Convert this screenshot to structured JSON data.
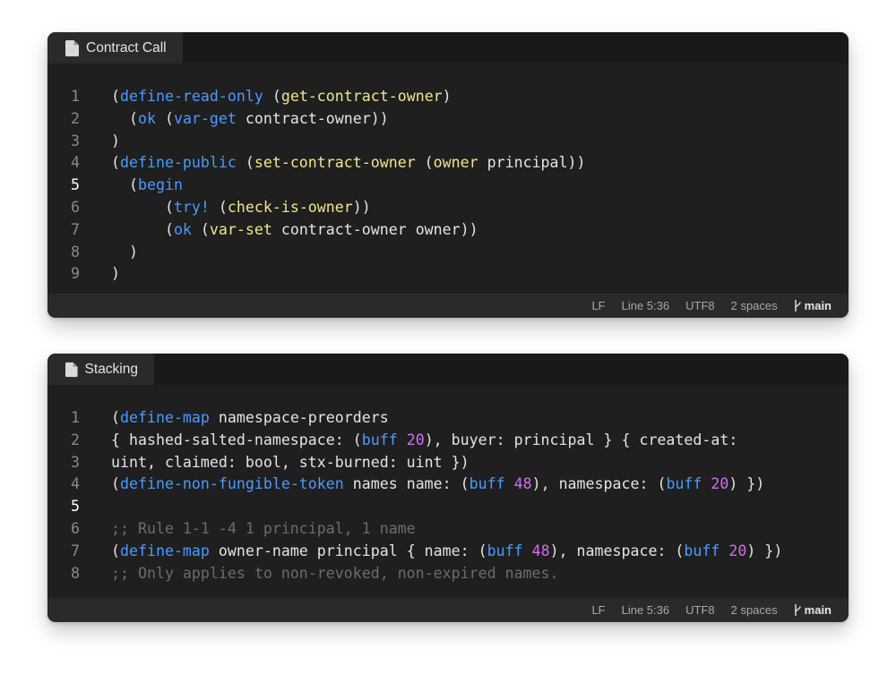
{
  "editors": [
    {
      "tab_icon": "file-icon",
      "tab_label": "Contract Call",
      "active_line": 5,
      "lines": [
        {
          "n": "1",
          "tokens": [
            {
              "t": "(",
              "c": "tx"
            },
            {
              "t": "define-read-only",
              "c": "kw"
            },
            {
              "t": " (",
              "c": "tx"
            },
            {
              "t": "get-contract-owner",
              "c": "fn"
            },
            {
              "t": ")",
              "c": "tx"
            }
          ]
        },
        {
          "n": "2",
          "tokens": [
            {
              "t": "  (",
              "c": "tx"
            },
            {
              "t": "ok",
              "c": "kw"
            },
            {
              "t": " (",
              "c": "tx"
            },
            {
              "t": "var-get",
              "c": "kw"
            },
            {
              "t": " contract-owner))",
              "c": "tx"
            }
          ]
        },
        {
          "n": "3",
          "tokens": [
            {
              "t": ")",
              "c": "tx"
            }
          ]
        },
        {
          "n": "4",
          "tokens": [
            {
              "t": "(",
              "c": "tx"
            },
            {
              "t": "define-public",
              "c": "kw"
            },
            {
              "t": " (",
              "c": "tx"
            },
            {
              "t": "set-contract-owner",
              "c": "fn"
            },
            {
              "t": " (",
              "c": "tx"
            },
            {
              "t": "owner",
              "c": "fn"
            },
            {
              "t": " principal))",
              "c": "tx"
            }
          ]
        },
        {
          "n": "5",
          "tokens": [
            {
              "t": "  (",
              "c": "tx"
            },
            {
              "t": "begin",
              "c": "kw"
            }
          ]
        },
        {
          "n": "6",
          "tokens": [
            {
              "t": "      (",
              "c": "tx"
            },
            {
              "t": "try!",
              "c": "kw"
            },
            {
              "t": " (",
              "c": "tx"
            },
            {
              "t": "check-is-owner",
              "c": "fn"
            },
            {
              "t": "))",
              "c": "tx"
            }
          ]
        },
        {
          "n": "7",
          "tokens": [
            {
              "t": "      (",
              "c": "tx"
            },
            {
              "t": "ok",
              "c": "kw"
            },
            {
              "t": " (",
              "c": "tx"
            },
            {
              "t": "var-set",
              "c": "fn"
            },
            {
              "t": " contract-owner owner))",
              "c": "tx"
            }
          ]
        },
        {
          "n": "8",
          "tokens": [
            {
              "t": "  )",
              "c": "tx"
            }
          ]
        },
        {
          "n": "9",
          "tokens": [
            {
              "t": ")",
              "c": "tx"
            }
          ]
        }
      ],
      "status": {
        "eol": "LF",
        "position": "Line 5:36",
        "encoding": "UTF8",
        "indent": "2 spaces",
        "branch_icon": "git-branch-icon",
        "branch": "main"
      }
    },
    {
      "tab_icon": "file-icon",
      "tab_label": "Stacking",
      "active_line": 5,
      "lines": [
        {
          "n": "1",
          "tokens": [
            {
              "t": "(",
              "c": "tx"
            },
            {
              "t": "define-map",
              "c": "kw"
            },
            {
              "t": " namespace-preorders",
              "c": "tx"
            }
          ]
        },
        {
          "n": "2",
          "tokens": [
            {
              "t": "{ hashed-salted-namespace: (",
              "c": "tx"
            },
            {
              "t": "buff",
              "c": "kw"
            },
            {
              "t": " ",
              "c": "tx"
            },
            {
              "t": "20",
              "c": "num"
            },
            {
              "t": "), buyer: principal } { created-at:",
              "c": "tx"
            }
          ]
        },
        {
          "n": "3",
          "tokens": [
            {
              "t": "uint, claimed: bool, stx-burned: uint })",
              "c": "tx"
            }
          ]
        },
        {
          "n": "4",
          "tokens": [
            {
              "t": "(",
              "c": "tx"
            },
            {
              "t": "define-non-fungible-token",
              "c": "kw"
            },
            {
              "t": " names name: (",
              "c": "tx"
            },
            {
              "t": "buff",
              "c": "kw"
            },
            {
              "t": " ",
              "c": "tx"
            },
            {
              "t": "48",
              "c": "num"
            },
            {
              "t": "), namespace: (",
              "c": "tx"
            },
            {
              "t": "buff",
              "c": "kw"
            },
            {
              "t": " ",
              "c": "tx"
            },
            {
              "t": "20",
              "c": "num"
            },
            {
              "t": ") })",
              "c": "tx"
            }
          ]
        },
        {
          "n": "5",
          "tokens": []
        },
        {
          "n": "6",
          "tokens": [
            {
              "t": ";; Rule 1-1 -4 1 principal, 1 name",
              "c": "cm"
            }
          ]
        },
        {
          "n": "7",
          "tokens": [
            {
              "t": "(",
              "c": "tx"
            },
            {
              "t": "define-map",
              "c": "kw"
            },
            {
              "t": " owner-name principal { name: (",
              "c": "tx"
            },
            {
              "t": "buff",
              "c": "kw"
            },
            {
              "t": " ",
              "c": "tx"
            },
            {
              "t": "48",
              "c": "num"
            },
            {
              "t": "), namespace: (",
              "c": "tx"
            },
            {
              "t": "buff",
              "c": "kw"
            },
            {
              "t": " ",
              "c": "tx"
            },
            {
              "t": "20",
              "c": "num"
            },
            {
              "t": ") })",
              "c": "tx"
            }
          ]
        },
        {
          "n": "8",
          "tokens": [
            {
              "t": ";; Only applies to non-revoked, non-expired names.",
              "c": "cm"
            }
          ]
        }
      ],
      "status": {
        "eol": "LF",
        "position": "Line 5:36",
        "encoding": "UTF8",
        "indent": "2 spaces",
        "branch_icon": "git-branch-icon",
        "branch": "main"
      }
    }
  ],
  "colors": {
    "editor_bg": "#1f1f1f",
    "tab_bg": "#2a2a2a",
    "keyword": "#4c9aff",
    "function": "#f1e58b",
    "number": "#d66df0",
    "comment": "#6c6c6c",
    "text": "#e4e4e4"
  }
}
